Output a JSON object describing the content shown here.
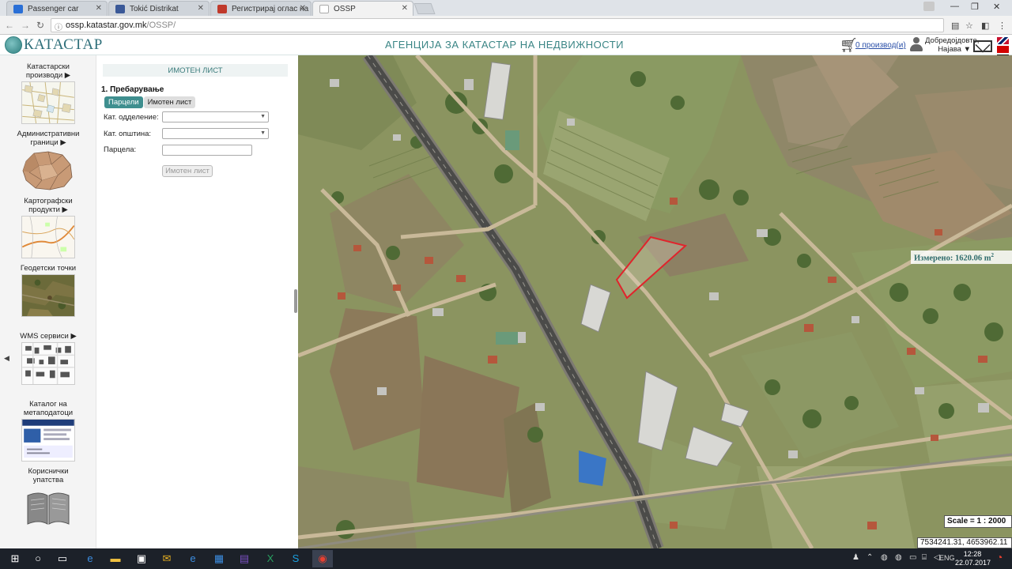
{
  "browser": {
    "tabs": [
      {
        "label": "Passenger car",
        "favicon_color": "#2a6fd6",
        "active": false
      },
      {
        "label": "Tokić Distrikat",
        "favicon_color": "#3b5998",
        "active": false
      },
      {
        "label": "Регистрирај оглас на Ре",
        "favicon_color": "#c0392b",
        "active": false
      },
      {
        "label": "OSSP",
        "favicon_color": "#ffffff",
        "active": true
      }
    ],
    "url_host": "ossp.katastar.gov.mk",
    "url_path": "/OSSP/"
  },
  "header": {
    "logo_text": "КАТАСТАР",
    "agency_title": "АГЕНЦИЈА ЗА КАТАСТАР НА НЕДВИЖНОСТИ",
    "cart_link": "0 производ(и)",
    "welcome_line1": "Добредојдовте,",
    "welcome_line2": "Најава ▼"
  },
  "sidebar": {
    "items": [
      {
        "label": "Катастарски производи ▶",
        "thumb": "cadastre-map"
      },
      {
        "label": "Административни граници ▶",
        "thumb": "boundaries-map"
      },
      {
        "label": "Картографски продукти ▶",
        "thumb": "topo-map"
      },
      {
        "label": "Геодетски точки",
        "thumb": "ortho-photo"
      },
      {
        "label": "WMS сервиси ▶",
        "thumb": "buildings-map"
      },
      {
        "label": "Каталог на метаподатоци",
        "thumb": "catalog-screenshot"
      },
      {
        "label": "Кориснички упатства",
        "thumb": "book-icon"
      }
    ]
  },
  "panel": {
    "title": "ИМОТЕН ЛИСТ",
    "step": "1. Пребарување",
    "tab_parcels": "Парцели",
    "tab_property_sheet": "Имотен лист",
    "label_department": "Кат. одделение:",
    "label_municipality": "Кат. општина:",
    "label_parcel": "Парцела:",
    "button": "Имотен лист"
  },
  "map": {
    "measured": "Измерено: 1620.06 m",
    "measured_sup": "2",
    "scale": "Scale = 1 : 2000",
    "coords": "7534241.31, 4653962.11",
    "tools": [
      "pan-icon",
      "zoom-in-icon",
      "zoom-out-icon",
      "speech-bubble-icon",
      "search-icon",
      "info-icon",
      "ruler-icon",
      "area-measure-icon",
      "location-pin-icon",
      "layers-icon"
    ],
    "highlight_color": "#e0242c"
  },
  "taskbar": {
    "lang": "ENG",
    "time": "12:28",
    "date": "22.07.2017"
  }
}
